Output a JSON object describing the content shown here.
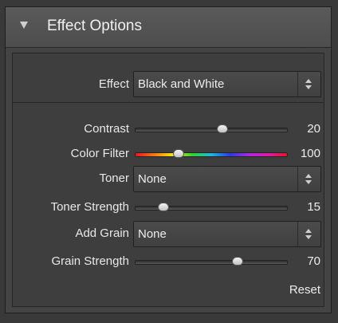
{
  "panel": {
    "title": "Effect Options"
  },
  "effect": {
    "label": "Effect",
    "value": "Black and White"
  },
  "sliders": {
    "contrast": {
      "label": "Contrast",
      "value": "20",
      "fraction": 0.58
    },
    "color_filter": {
      "label": "Color Filter",
      "value": "100",
      "fraction": 0.29
    },
    "toner_strength": {
      "label": "Toner Strength",
      "value": "15",
      "fraction": 0.19
    },
    "grain_strength": {
      "label": "Grain Strength",
      "value": "70",
      "fraction": 0.68
    }
  },
  "toner": {
    "label": "Toner",
    "value": "None"
  },
  "add_grain": {
    "label": "Add Grain",
    "value": "None"
  },
  "reset_label": "Reset"
}
